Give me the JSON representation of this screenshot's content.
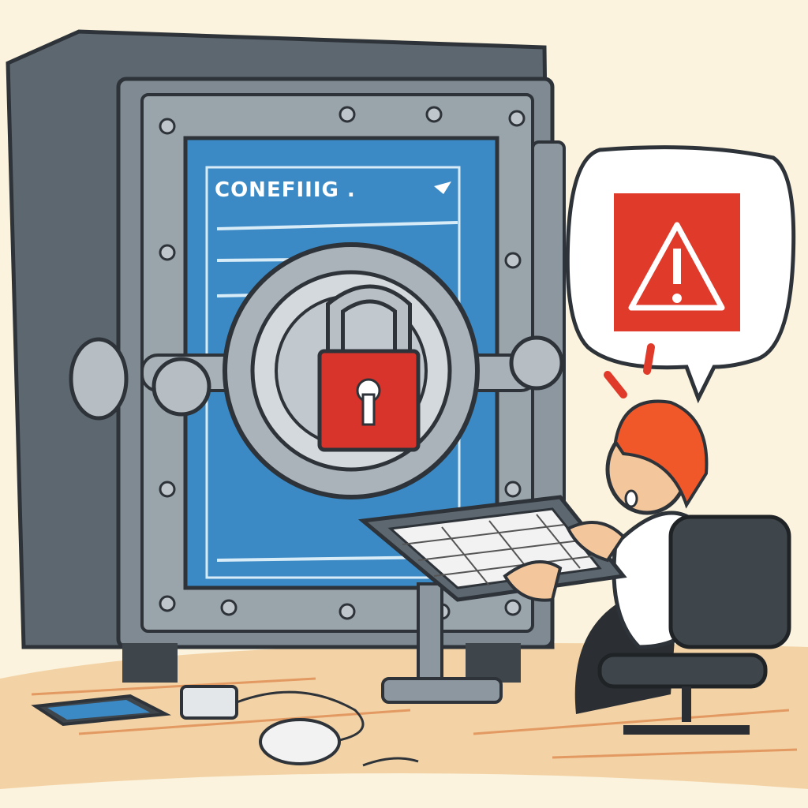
{
  "screen": {
    "title_text": "CONEFIIIG ."
  },
  "icons": [
    "padlock-icon",
    "warning-icon",
    "keyhole-icon",
    "chevron-down-icon"
  ],
  "colors": {
    "background": "#fbf3dd",
    "safe_body": "#5d6770",
    "safe_door": "#8d979f",
    "screen": "#3b8ac6",
    "padlock": "#d9342b",
    "warning": "#e03a2a",
    "hair": "#f0582a",
    "floor": "#e9b27a"
  }
}
